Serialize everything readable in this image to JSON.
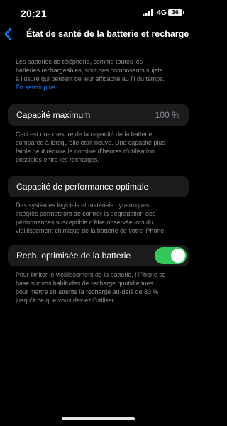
{
  "status": {
    "time": "20:21",
    "network": "4G",
    "battery": "36"
  },
  "nav": {
    "title": "État de santé de la batterie et recharge"
  },
  "intro": {
    "lines": [
      "Les batteries de téléphone, comme toutes les",
      "batteries rechargeables, sont des composants sujets",
      "à l’usure qui perdent de leur efficacité au fil du temps."
    ],
    "link": "En savoir plus…"
  },
  "capacity": {
    "label": "Capacité maximum",
    "value": "100 %",
    "footer": [
      "Ceci est une mesure de la capacité de la batterie",
      "comparée à lorsqu’elle était neuve. Une capacité plus",
      "faible peut réduire le nombre d’heures d’utilisation",
      "possibles entre les recharges."
    ]
  },
  "performance": {
    "label": "Capacité de performance optimale",
    "footer": [
      "Des systèmes logiciels et matériels dynamiques",
      "intégrés permettront de contrer la dégradation des",
      "performances susceptible d’être observée lors du",
      "vieillissement chimique de la batterie de votre iPhone."
    ]
  },
  "optimized": {
    "label": "Rech. optimisée de la batterie",
    "enabled": true,
    "footer": [
      "Pour limiter le vieillissement de la batterie, l’iPhone se",
      "base sur vos habitudes de recharge quotidiennes",
      "pour mettre en attente la recharge au-delà de 80 %",
      "jusqu’à ce que vous deviez l’utiliser."
    ]
  },
  "colors": {
    "accent": "#0a84ff",
    "toggle_on": "#34c759",
    "cell_bg": "#1c1c1e",
    "secondary_text": "#8e8e93"
  },
  "icons": {
    "back": "chevron-left-icon",
    "signal": "cellular-signal-icon",
    "battery": "battery-icon"
  }
}
